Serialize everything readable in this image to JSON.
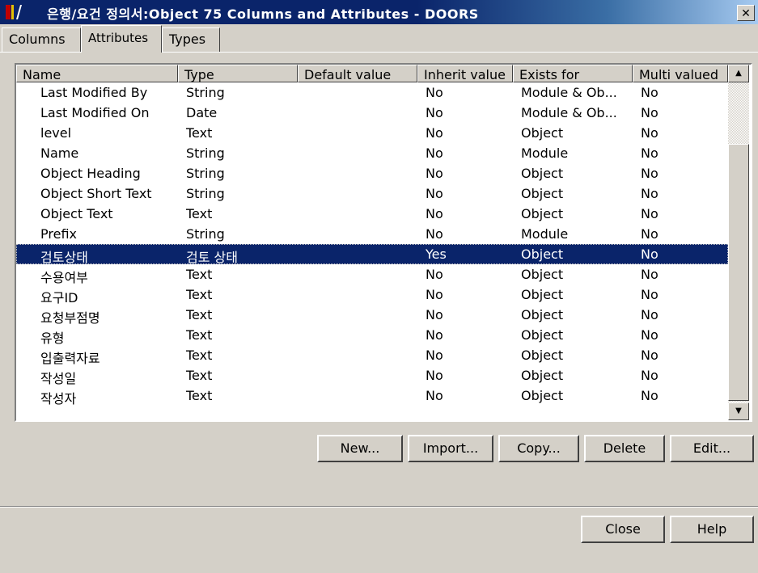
{
  "window": {
    "title": "은행/요건 정의서:Object 75 Columns and Attributes - DOORS",
    "close_label": "✕",
    "icon": "doors-app-icon"
  },
  "tabs": [
    {
      "label": "Columns",
      "active": false
    },
    {
      "label": "Attributes",
      "active": true
    },
    {
      "label": "Types",
      "active": false
    }
  ],
  "table": {
    "columns": [
      "Name",
      "Type",
      "Default value",
      "Inherit value",
      "Exists for",
      "Multi valued"
    ],
    "rows": [
      {
        "name": "Last Modified By",
        "type": "String",
        "default": "",
        "inherit": "No",
        "exists": "Module & Ob...",
        "multi": "No"
      },
      {
        "name": "Last Modified On",
        "type": "Date",
        "default": "",
        "inherit": "No",
        "exists": "Module & Ob...",
        "multi": "No"
      },
      {
        "name": "level",
        "type": "Text",
        "default": "",
        "inherit": "No",
        "exists": "Object",
        "multi": "No"
      },
      {
        "name": "Name",
        "type": "String",
        "default": "",
        "inherit": "No",
        "exists": "Module",
        "multi": "No"
      },
      {
        "name": "Object Heading",
        "type": "String",
        "default": "",
        "inherit": "No",
        "exists": "Object",
        "multi": "No"
      },
      {
        "name": "Object Short Text",
        "type": "String",
        "default": "",
        "inherit": "No",
        "exists": "Object",
        "multi": "No"
      },
      {
        "name": "Object Text",
        "type": "Text",
        "default": "",
        "inherit": "No",
        "exists": "Object",
        "multi": "No"
      },
      {
        "name": "Prefix",
        "type": "String",
        "default": "",
        "inherit": "No",
        "exists": "Module",
        "multi": "No"
      },
      {
        "name": "검토상태",
        "type": "검토 상태",
        "default": "",
        "inherit": "Yes",
        "exists": "Object",
        "multi": "No",
        "selected": true
      },
      {
        "name": "수용여부",
        "type": "Text",
        "default": "",
        "inherit": "No",
        "exists": "Object",
        "multi": "No"
      },
      {
        "name": "요구ID",
        "type": "Text",
        "default": "",
        "inherit": "No",
        "exists": "Object",
        "multi": "No"
      },
      {
        "name": "요청부점명",
        "type": "Text",
        "default": "",
        "inherit": "No",
        "exists": "Object",
        "multi": "No"
      },
      {
        "name": "유형",
        "type": "Text",
        "default": "",
        "inherit": "No",
        "exists": "Object",
        "multi": "No"
      },
      {
        "name": "입출력자료",
        "type": "Text",
        "default": "",
        "inherit": "No",
        "exists": "Object",
        "multi": "No"
      },
      {
        "name": "작성일",
        "type": "Text",
        "default": "",
        "inherit": "No",
        "exists": "Object",
        "multi": "No"
      },
      {
        "name": "작성자",
        "type": "Text",
        "default": "",
        "inherit": "No",
        "exists": "Object",
        "multi": "No"
      }
    ]
  },
  "scrollbar": {
    "up_arrow": "▲",
    "down_arrow": "▼"
  },
  "actions": {
    "new": "New...",
    "import": "Import...",
    "copy": "Copy...",
    "delete": "Delete",
    "edit": "Edit..."
  },
  "footer": {
    "close": "Close",
    "help": "Help"
  },
  "colors": {
    "title_bar": "#0a246a",
    "selection": "#0a246a",
    "face": "#d4d0c8"
  }
}
